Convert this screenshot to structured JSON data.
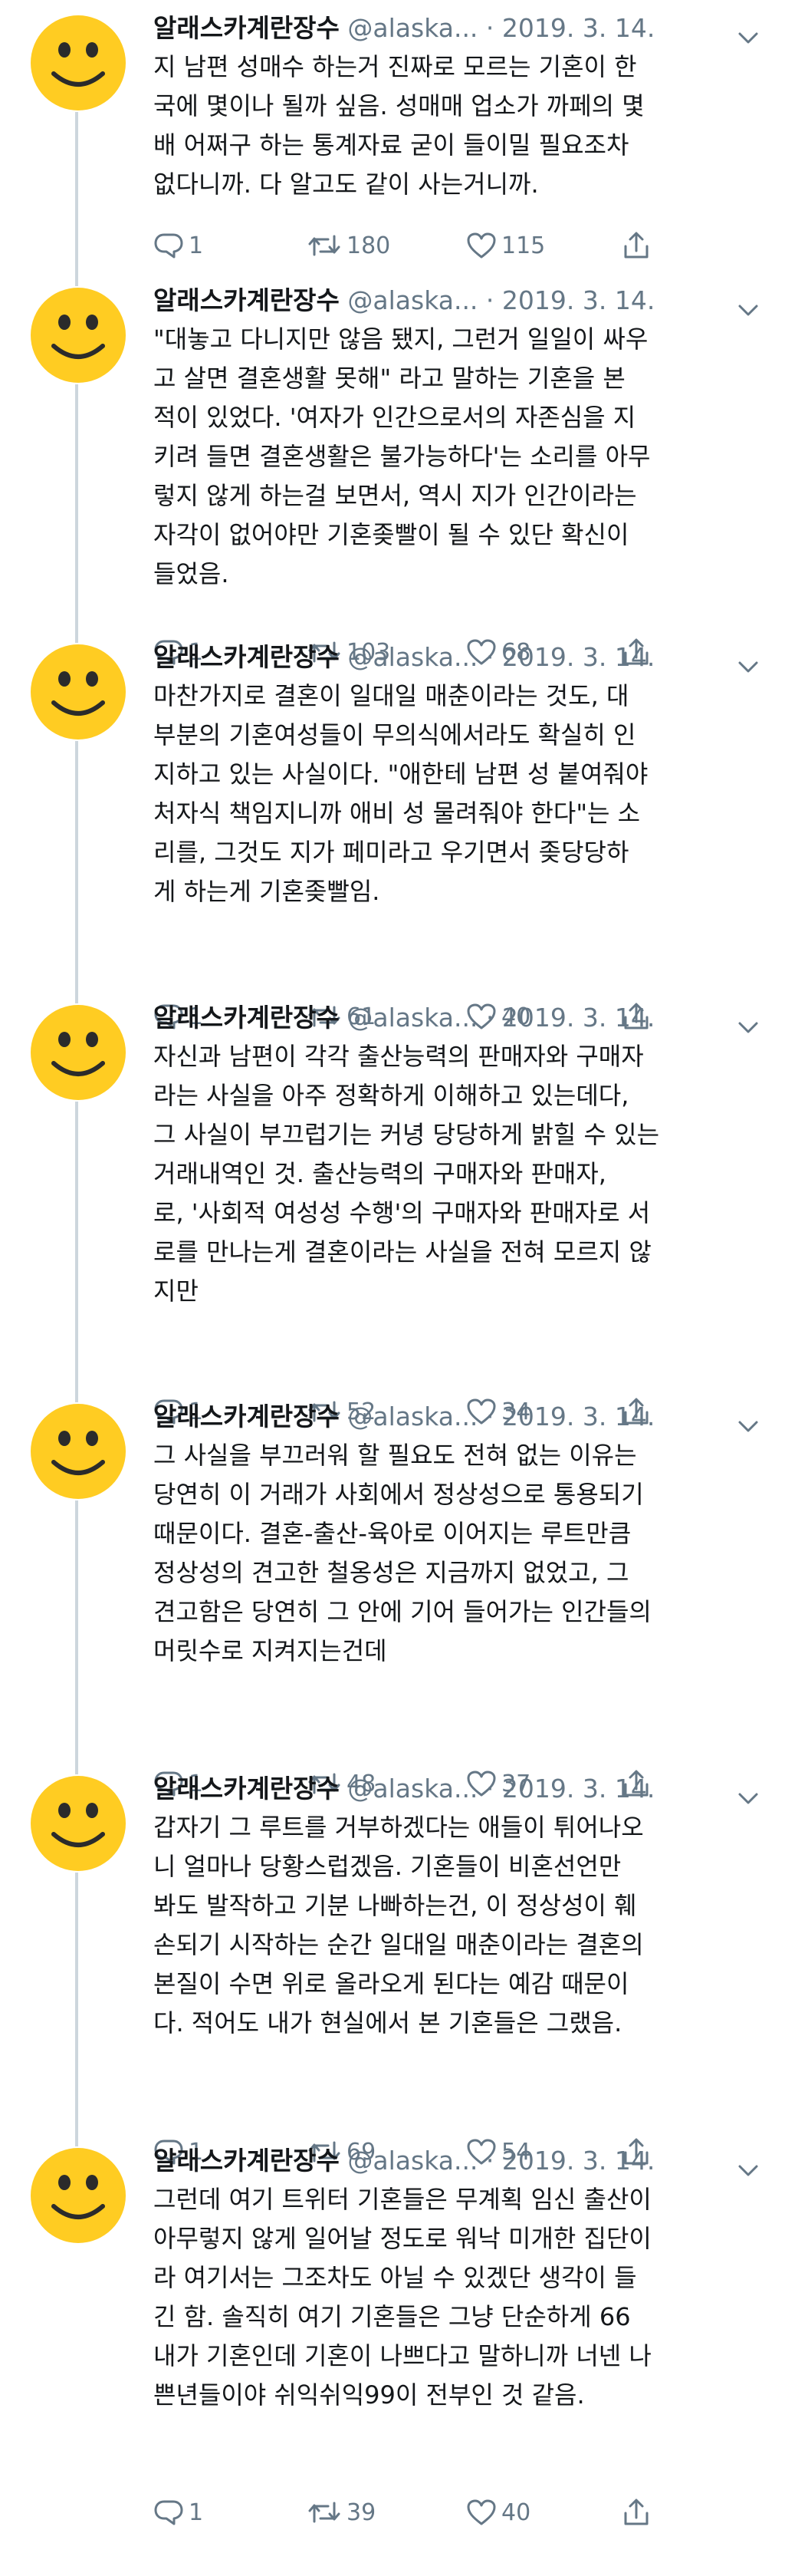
{
  "colors": {
    "text": "#14171a",
    "secondary": "#657786",
    "thread_line": "#cdd6dd",
    "avatar_face": "#FFCC22",
    "avatar_features": "#2b2b2b"
  },
  "icons": {
    "avatar": "smiley-face-icon",
    "caret": "chevron-down-icon",
    "reply": "reply-icon",
    "retweet": "retweet-icon",
    "like": "heart-icon",
    "share": "share-icon"
  },
  "tweets": [
    {
      "name": "알래스카계란장수",
      "handle": "@alaska...",
      "separator": "·",
      "date": "2019. 3. 14.",
      "lines": [
        "지 남편 성매수 하는거 진짜로 모르는 기혼이 한",
        "국에 몇이나 될까 싶음. 성매매 업소가 까페의 몇",
        "배 어쩌구 하는 통계자료 굳이 들이밀 필요조차",
        "없다니까. 다 알고도 같이 사는거니까."
      ],
      "replies": "1",
      "retweets": "180",
      "likes": "115"
    },
    {
      "name": "알래스카계란장수",
      "handle": "@alaska...",
      "separator": "·",
      "date": "2019. 3. 14.",
      "lines": [
        "\"대놓고 다니지만 않음 됐지, 그런거 일일이 싸우",
        "고 살면 결혼생활 못해\" 라고 말하는 기혼을 본",
        "적이 있었다. '여자가 인간으로서의 자존심을 지",
        "키려 들면 결혼생활은 불가능하다'는 소리를 아무",
        "렇지 않게 하는걸 보면서, 역시 지가 인간이라는",
        "자각이 없어야만 기혼좆빨이 될 수 있단 확신이",
        "들었음."
      ],
      "replies": "1",
      "retweets": "103",
      "likes": "68"
    },
    {
      "name": "알래스카계란장수",
      "handle": "@alaska...",
      "separator": "·",
      "date": "2019. 3. 14.",
      "lines": [
        "마찬가지로 결혼이 일대일 매춘이라는 것도, 대",
        "부분의 기혼여성들이 무의식에서라도 확실히 인",
        "지하고 있는 사실이다. \"애한테 남편 성 붙여줘야",
        "처자식 책임지니까 애비 성 물려줘야 한다\"는 소",
        "리를, 그것도 지가 페미라고 우기면서 좆당당하",
        "게 하는게 기혼좆빨임."
      ],
      "replies": "1",
      "retweets": "61",
      "likes": "40"
    },
    {
      "name": "알래스카계란장수",
      "handle": "@alaska...",
      "separator": "·",
      "date": "2019. 3. 14.",
      "lines": [
        "자신과 남편이 각각 출산능력의 판매자와 구매자",
        "라는 사실을 아주 정확하게 이해하고 있는데다,",
        "그 사실이 부끄럽기는 커녕 당당하게 밝힐 수 있는",
        "거래내역인 것. 출산능력의 구매자와 판매자,",
        "로, '사회적 여성성 수행'의 구매자와 판매자로 서",
        "로를 만나는게 결혼이라는 사실을 전혀 모르지 않",
        "지만"
      ],
      "replies": "1",
      "retweets": "52",
      "likes": "34"
    },
    {
      "name": "알래스카계란장수",
      "handle": "@alaska...",
      "separator": "·",
      "date": "2019. 3. 14.",
      "lines": [
        "그 사실을 부끄러워 할 필요도 전혀 없는 이유는",
        "당연히 이 거래가 사회에서 정상성으로 통용되기",
        "때문이다. 결혼-출산-육아로 이어지는 루트만큼",
        "정상성의 견고한 철옹성은 지금까지 없었고, 그",
        "견고함은 당연히 그 안에 기어 들어가는 인간들의",
        "머릿수로 지켜지는건데"
      ],
      "replies": "1",
      "retweets": "48",
      "likes": "37"
    },
    {
      "name": "알래스카계란장수",
      "handle": "@alaska...",
      "separator": "·",
      "date": "2019. 3. 14.",
      "lines": [
        "갑자기 그 루트를 거부하겠다는 애들이 튀어나오",
        "니 얼마나 당황스럽겠음. 기혼들이 비혼선언만",
        "봐도 발작하고 기분 나빠하는건, 이 정상성이 훼",
        "손되기 시작하는 순간 일대일 매춘이라는 결혼의",
        "본질이 수면 위로 올라오게 된다는 예감 때문이",
        "다. 적어도 내가 현실에서 본 기혼들은 그랬음."
      ],
      "replies": "1",
      "retweets": "69",
      "likes": "54"
    },
    {
      "name": "알래스카계란장수",
      "handle": "@alaska...",
      "separator": "·",
      "date": "2019. 3. 14.",
      "lines": [
        "그런데 여기 트위터 기혼들은 무계획 임신 출산이",
        "아무렇지 않게 일어날 정도로 워낙 미개한 집단이",
        "라 여기서는 그조차도 아닐 수 있겠단 생각이 들",
        "긴 함. 솔직히 여기 기혼들은 그냥 단순하게 66",
        "내가 기혼인데 기혼이 나쁘다고 말하니까 너넨 나",
        "쁜년들이야 쉬익쉬익99이 전부인 것 같음."
      ],
      "replies": "1",
      "retweets": "39",
      "likes": "40"
    }
  ]
}
